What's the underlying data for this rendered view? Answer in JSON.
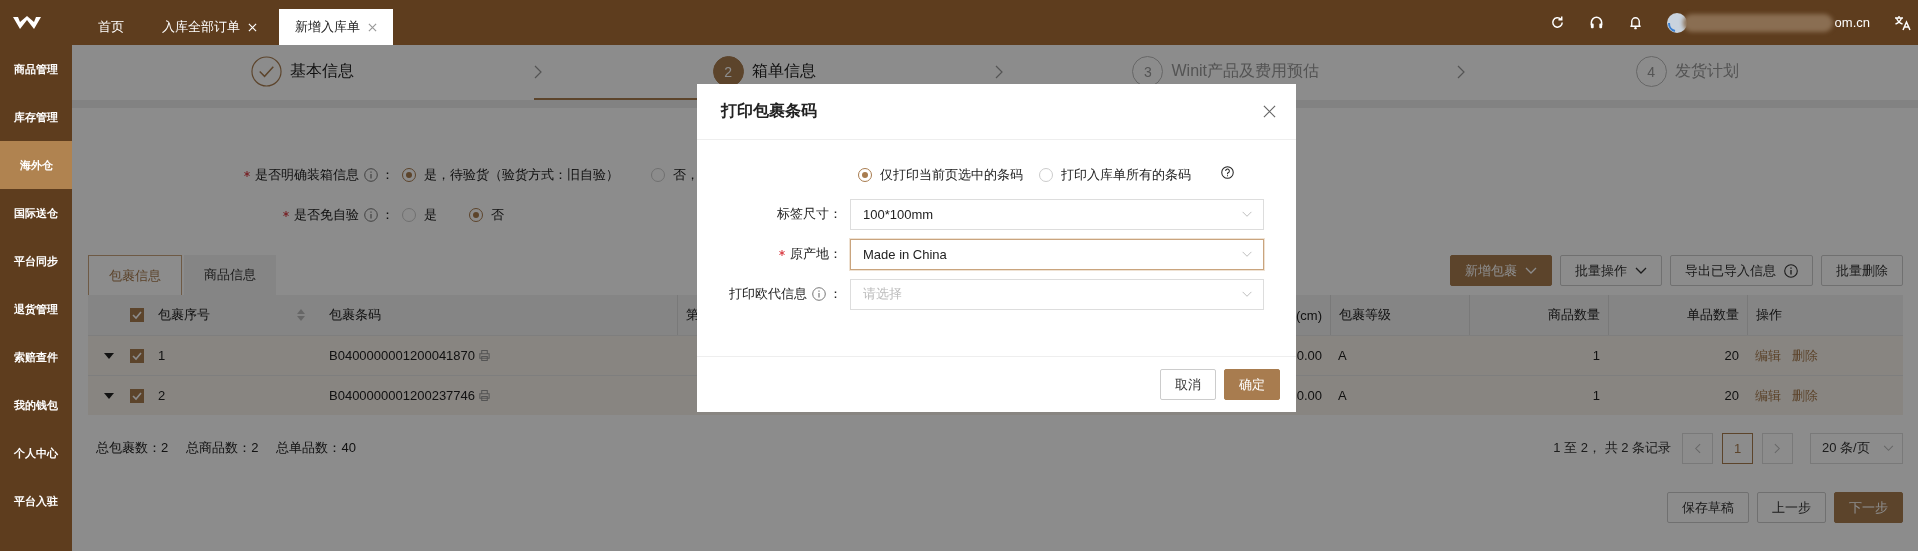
{
  "top_bar": {
    "tabs": [
      {
        "label": "首页",
        "closable": false,
        "selected": false
      },
      {
        "label": "入库全部订单",
        "closable": true,
        "selected": false
      },
      {
        "label": "新增入库单",
        "closable": true,
        "selected": true
      }
    ],
    "account": "om.cn"
  },
  "sidebar": {
    "items": [
      {
        "label": "商品管理",
        "selected": false
      },
      {
        "label": "库存管理",
        "selected": false
      },
      {
        "label": "海外仓",
        "selected": true
      },
      {
        "label": "国际送仓",
        "selected": false
      },
      {
        "label": "平台同步",
        "selected": false
      },
      {
        "label": "退货管理",
        "selected": false
      },
      {
        "label": "索赔查件",
        "selected": false
      },
      {
        "label": "我的钱包",
        "selected": false
      },
      {
        "label": "个人中心",
        "selected": false
      },
      {
        "label": "平台入驻",
        "selected": false
      }
    ]
  },
  "steps": [
    {
      "label": "基本信息",
      "done": true,
      "current": false
    },
    {
      "number": "2",
      "label": "箱单信息",
      "done": false,
      "current": true
    },
    {
      "number": "3",
      "label": "Winit产品及费用预估",
      "done": false,
      "current": false
    },
    {
      "number": "4",
      "label": "发货计划",
      "done": false,
      "current": false
    }
  ],
  "form": [
    {
      "label": "是否明确装箱信息",
      "required": true,
      "info": true,
      "colon": "：",
      "options": [
        {
          "label": "是，待验货（验货方式：旧自验）",
          "selected": true
        },
        {
          "label": "否，",
          "selected": false
        }
      ]
    },
    {
      "label": "是否免自验",
      "required": true,
      "info": true,
      "colon": "：",
      "options": [
        {
          "label": "是",
          "selected": false
        },
        {
          "label": "否",
          "selected": true
        }
      ]
    }
  ],
  "section_tabs": [
    {
      "label": "包裹信息",
      "selected": true
    },
    {
      "label": "商品信息",
      "selected": false
    }
  ],
  "actions": [
    {
      "label": "新增包裹",
      "primary": true,
      "dropdown": true,
      "info": false
    },
    {
      "label": "批量操作",
      "primary": false,
      "dropdown": true,
      "info": false
    },
    {
      "label": "导出已导入信息",
      "primary": false,
      "dropdown": false,
      "info": true
    },
    {
      "label": "批量删除",
      "primary": false,
      "dropdown": false,
      "info": false
    }
  ],
  "table": {
    "all_checked": true,
    "columns": [
      "包裹序号",
      "包裹条码",
      "第",
      "(cm)",
      "包裹等级",
      "商品数量",
      "单品数量",
      "操作"
    ],
    "rows": [
      {
        "expanded": false,
        "checked": true,
        "package_no": "1",
        "barcode": "B0400000001200041870",
        "column_4": "0.00",
        "grade": "A",
        "goods_qty": "1",
        "item_qty": "20",
        "actions": [
          "编辑",
          "删除"
        ]
      },
      {
        "expanded": false,
        "checked": true,
        "package_no": "2",
        "barcode": "B0400000001200237746",
        "column_4": "0.00",
        "grade": "A",
        "goods_qty": "1",
        "item_qty": "20",
        "actions": [
          "编辑",
          "删除"
        ]
      }
    ]
  },
  "summary": [
    "总包裹数：2",
    "总商品数：2",
    "总单品数：40"
  ],
  "pagination": {
    "range": "1 至 2， 共 2 条记录",
    "pages": [
      {
        "label": "1",
        "selected": true
      }
    ],
    "page_size": "20 条/页"
  },
  "footer_buttons": [
    {
      "label": "保存草稿",
      "primary": false
    },
    {
      "label": "上一步",
      "primary": false
    },
    {
      "label": "下一步",
      "primary": true
    }
  ],
  "dialog": {
    "title": "打印包裹条码",
    "scope_options": [
      {
        "label": "仅打印当前页选中的条码",
        "selected": true
      },
      {
        "label": "打印入库单所有的条码",
        "selected": false
      }
    ],
    "fields": [
      {
        "label": "标签尺寸：",
        "required": false,
        "info": false,
        "value": "100*100mm",
        "focused": false
      },
      {
        "label": "原产地：",
        "required": true,
        "info": false,
        "value": "Made in China",
        "focused": true
      },
      {
        "label": "打印欧代信息",
        "label_suffix": "：",
        "required": false,
        "info": true,
        "placeholder": "请选择",
        "focused": false
      }
    ],
    "buttons": [
      {
        "label": "取消",
        "primary": false
      },
      {
        "label": "确定",
        "primary": true
      }
    ]
  }
}
